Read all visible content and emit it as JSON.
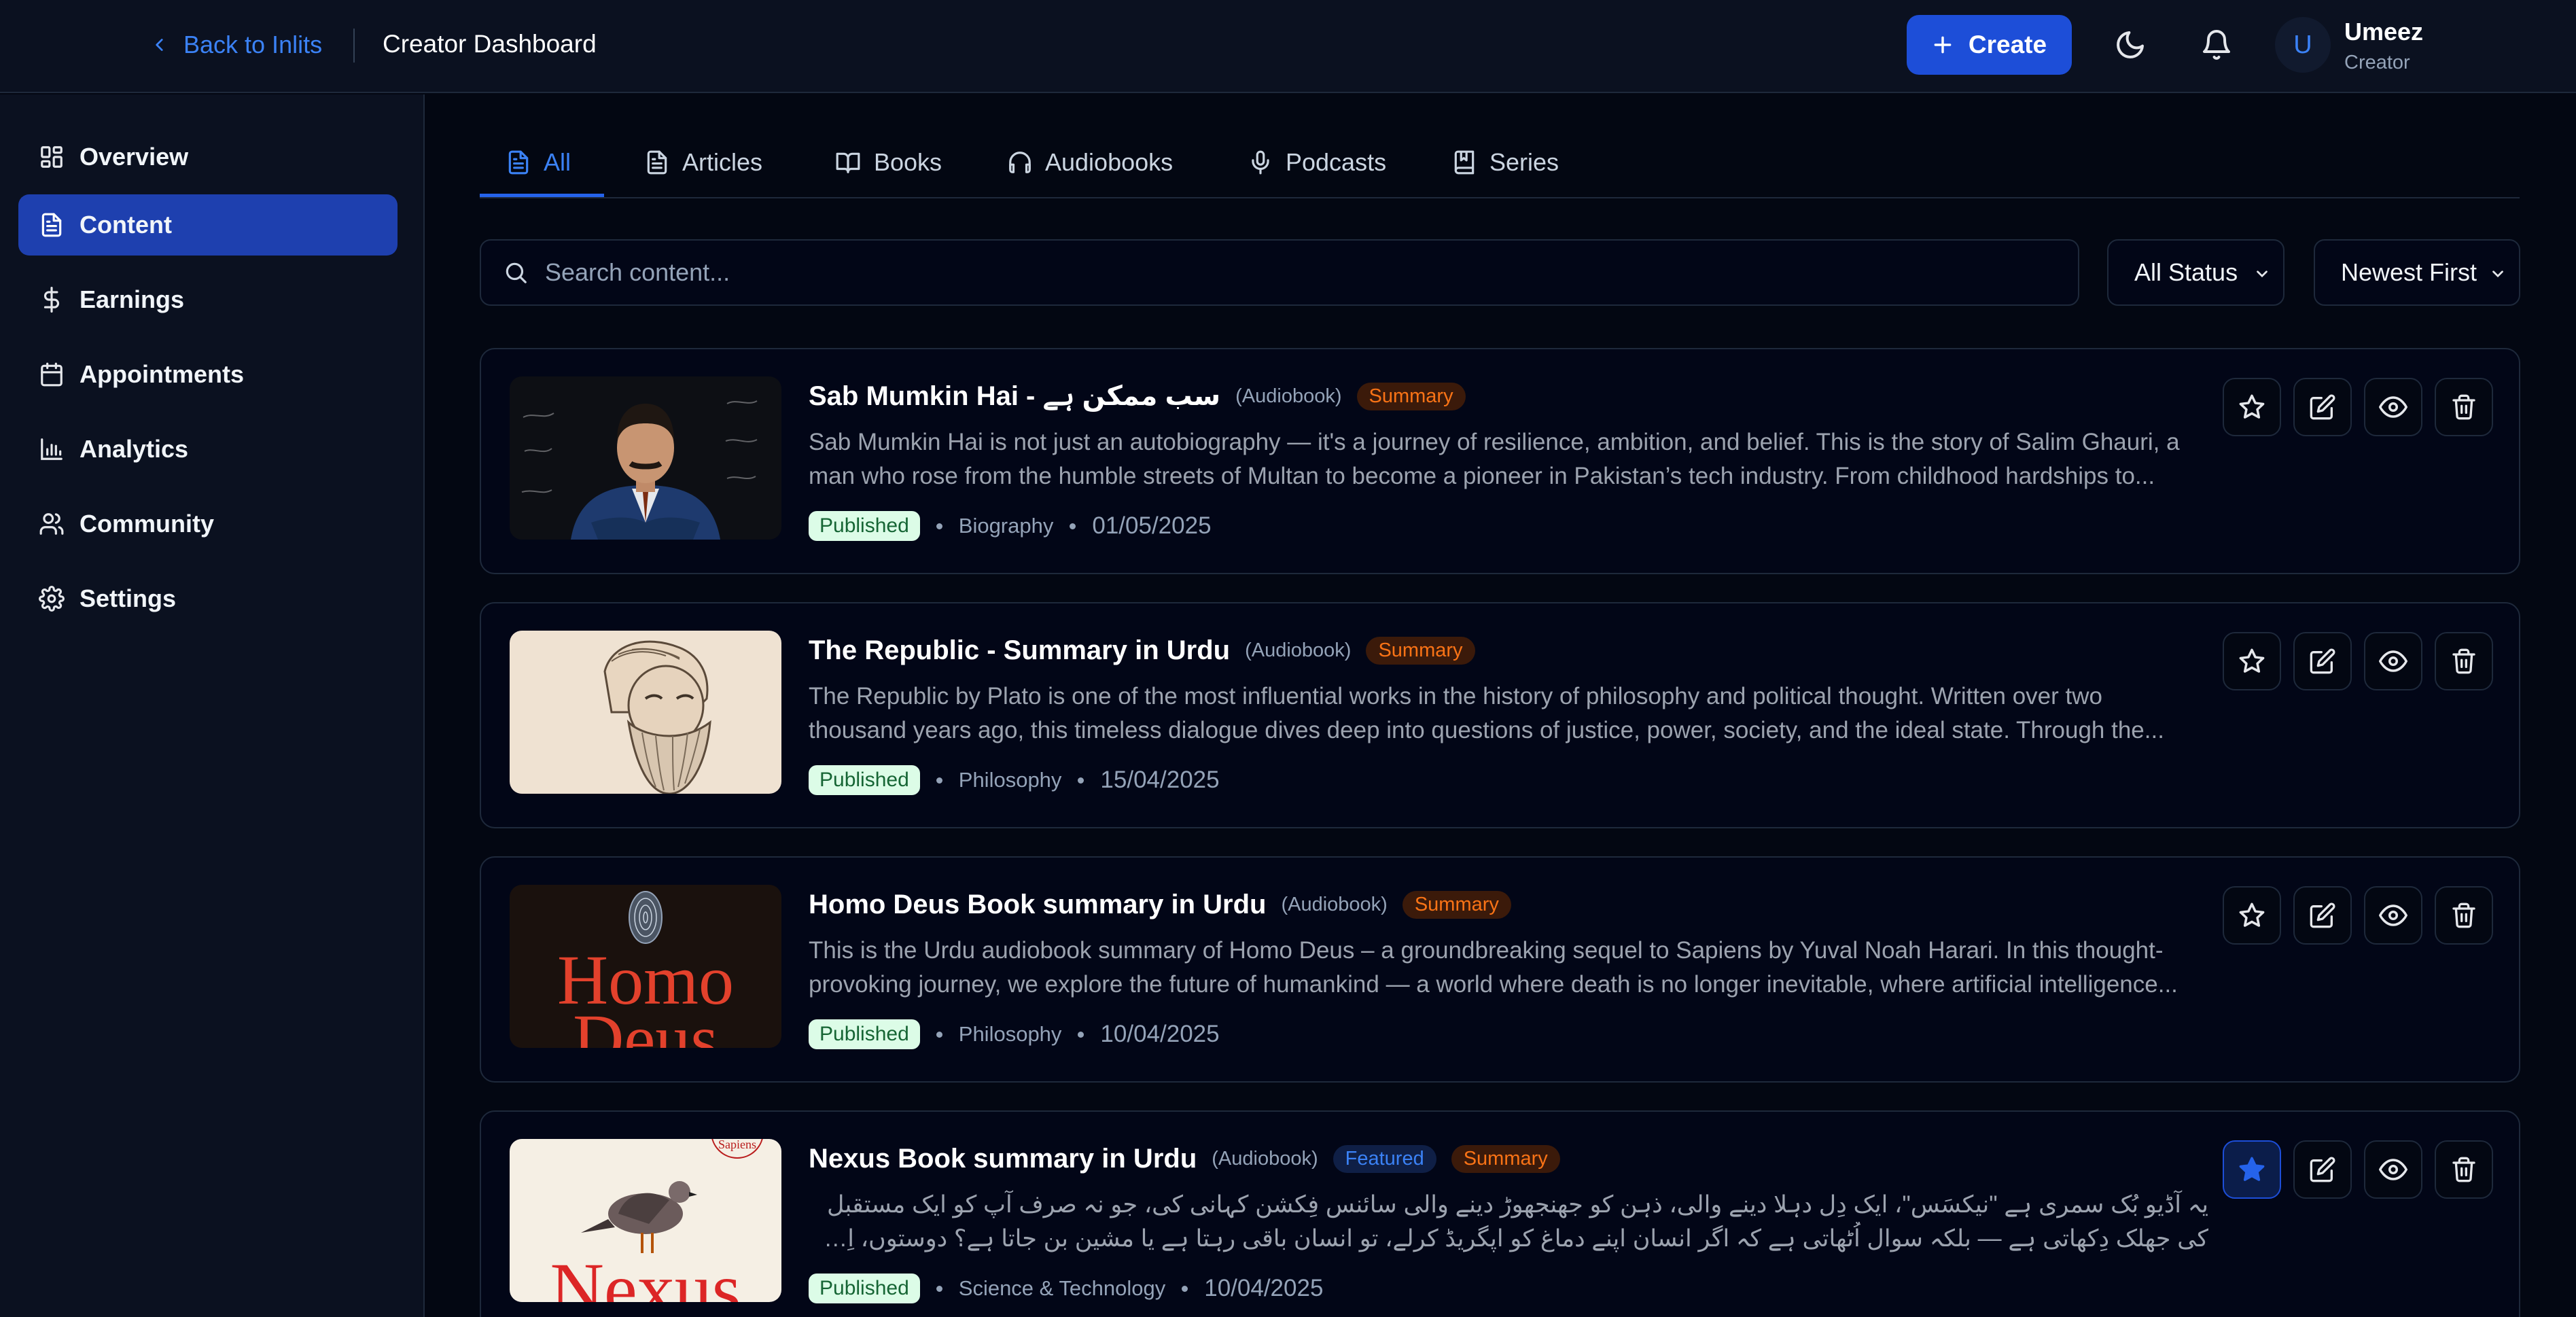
{
  "header": {
    "back_label": "Back to Inlits",
    "title": "Creator Dashboard",
    "create_label": "Create",
    "user": {
      "initial": "U",
      "name": "Umeez",
      "role": "Creator"
    }
  },
  "sidebar": {
    "items": [
      {
        "label": "Overview",
        "icon": "grid-icon"
      },
      {
        "label": "Content",
        "icon": "document-icon",
        "active": true
      },
      {
        "label": "Earnings",
        "icon": "dollar-icon"
      },
      {
        "label": "Appointments",
        "icon": "calendar-icon"
      },
      {
        "label": "Analytics",
        "icon": "bar-chart-icon"
      },
      {
        "label": "Community",
        "icon": "users-icon"
      },
      {
        "label": "Settings",
        "icon": "gear-icon"
      }
    ]
  },
  "tabs": [
    {
      "label": "All",
      "icon": "document-icon",
      "active": true
    },
    {
      "label": "Articles",
      "icon": "document-icon"
    },
    {
      "label": "Books",
      "icon": "book-open-icon"
    },
    {
      "label": "Audiobooks",
      "icon": "headphones-icon"
    },
    {
      "label": "Podcasts",
      "icon": "microphone-icon"
    },
    {
      "label": "Series",
      "icon": "bookmark-book-icon"
    }
  ],
  "search": {
    "placeholder": "Search content..."
  },
  "filters": {
    "status": "All Status",
    "sort": "Newest First"
  },
  "colors": {
    "accent": "#1d4ed8",
    "background": "#030712",
    "summary": "#f97316",
    "published_bg": "#dcfce7"
  },
  "content": [
    {
      "title": "Sab Mumkin Hai - سب ممکن ہے",
      "type": "(Audiobook)",
      "badges": [
        "Summary"
      ],
      "description_lines": [
        "Sab Mumkin Hai is not just an autobiography — it's a journey of resilience, ambition, and belief. This is the story of Salim Ghauri, a",
        "man who rose from the humble streets of Multan to become a pioneer in Pakistan’s tech industry. From childhood hardships to..."
      ],
      "status": "Published",
      "category": "Biography",
      "date": "01/05/2025",
      "starred": false
    },
    {
      "title": "The Republic - Summary in Urdu",
      "type": "(Audiobook)",
      "badges": [
        "Summary"
      ],
      "description_lines": [
        "The Republic by Plato is one of the most influential works in the history of philosophy and political thought. Written over two",
        "thousand years ago, this timeless dialogue dives deep into questions of justice, power, society, and the ideal state. Through the..."
      ],
      "status": "Published",
      "category": "Philosophy",
      "date": "15/04/2025",
      "starred": false
    },
    {
      "title": "Homo Deus Book summary in Urdu",
      "type": "(Audiobook)",
      "badges": [
        "Summary"
      ],
      "description_lines": [
        "This is the Urdu audiobook summary of Homo Deus – a groundbreaking sequel to Sapiens by Yuval Noah Harari. In this thought-",
        "provoking journey, we explore the future of humankind — a world where death is no longer inevitable, where artificial intelligence..."
      ],
      "status": "Published",
      "category": "Philosophy",
      "date": "10/04/2025",
      "starred": false
    },
    {
      "title": "Nexus Book summary in Urdu",
      "type": "(Audiobook)",
      "badges": [
        "Featured",
        "Summary"
      ],
      "description_lines": [
        "یہ آڈیو بُک سمری ہے \"نیکسَس\"، ایک دِل دہلا دینے والی، ذہن کو جھنجھوڑ دینے والی سائنس فِکشن کہانی کی، جو نہ صرف آپ کو ایک مستقبل",
        "کی جھلک دِکھاتی ہے — بلکہ سوال اُٹھاتی ہے کہ اگر انسان اپنے دماغ کو اپگریڈ کرلے، تو انسان باقی رہتا ہے یا مشین بن جاتا ہے؟ دوستوں، اِس..."
      ],
      "status": "Published",
      "category": "Science & Technology",
      "date": "10/04/2025",
      "starred": true
    }
  ],
  "thumb_text": {
    "homo_line1": "Homo",
    "homo_line2": "Deus",
    "nexus": "Nexus",
    "sapiens": "Sapiens"
  }
}
